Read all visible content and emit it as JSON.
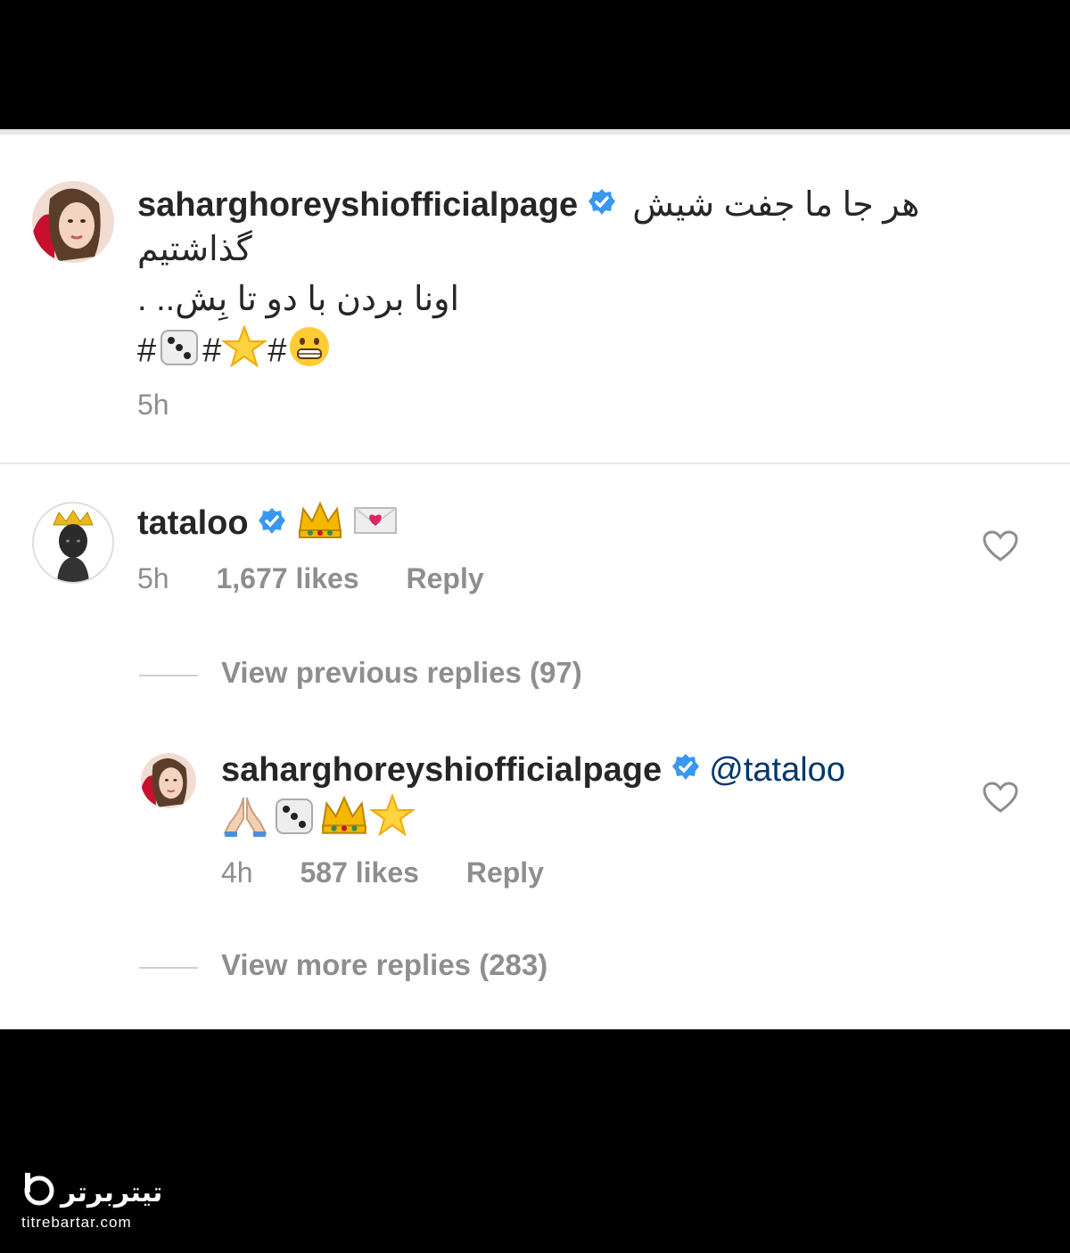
{
  "post": {
    "username": "saharghoreyshiofficialpage",
    "caption_line1": "هر جا ما جفت شیش",
    "caption_line2": "گذاشتیم",
    "caption_line3": "اونا بردن با دو تا بِش.. .",
    "hashtag_symbol": "#",
    "time": "5h"
  },
  "comment": {
    "username": "tataloo",
    "time": "5h",
    "likes": "1,677 likes",
    "reply_label": "Reply"
  },
  "view_previous": "View previous replies (97)",
  "reply": {
    "username": "saharghoreyshiofficialpage",
    "mention": "@tataloo",
    "time": "4h",
    "likes": "587 likes",
    "reply_label": "Reply"
  },
  "view_more": "View more replies (283)",
  "watermark": {
    "site": "titrebartar.com",
    "brand": "تیتربرتر"
  },
  "colors": {
    "verified": "#3897f0",
    "text": "#262626",
    "secondary": "#8e8e8e"
  },
  "icons": [
    "verified-badge-icon",
    "dice-emoji",
    "star-emoji",
    "grimace-emoji",
    "crown-emoji",
    "love-letter-emoji",
    "pray-emoji",
    "heart-icon"
  ]
}
